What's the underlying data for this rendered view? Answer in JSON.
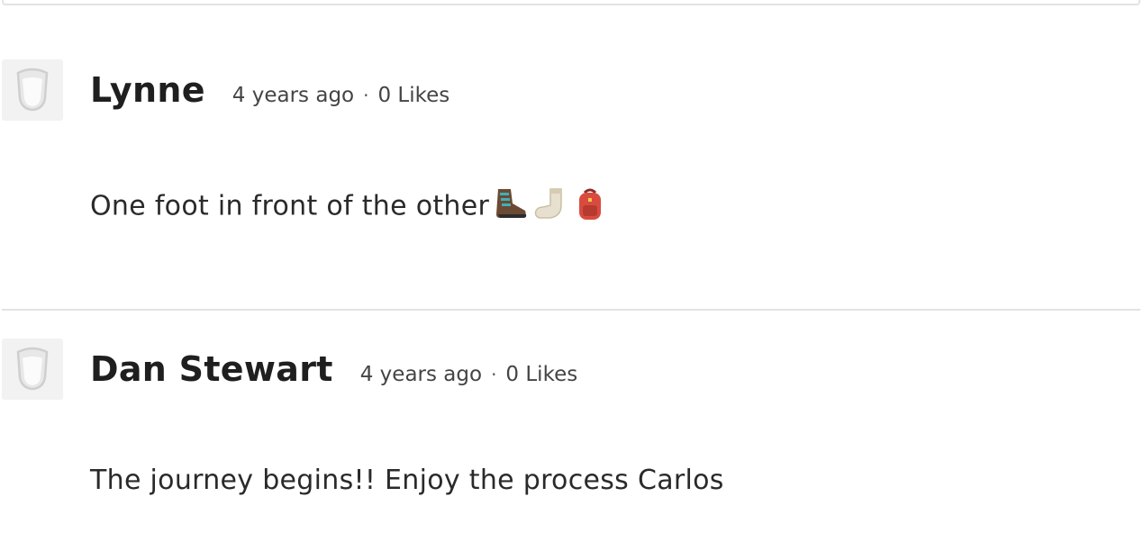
{
  "comments": [
    {
      "author": "Lynne",
      "time": "4 years ago",
      "separator": "·",
      "likes": "0 Likes",
      "text": "One foot in front of the other",
      "emoji_icons": [
        "hiking-boot-icon",
        "sock-icon",
        "backpack-icon"
      ]
    },
    {
      "author": "Dan Stewart",
      "time": "4 years ago",
      "separator": "·",
      "likes": "0 Likes",
      "text": "The journey begins!! Enjoy the process Carlos",
      "emoji_icons": []
    }
  ],
  "colors": {
    "avatar_bg": "#f2f2f2",
    "divider": "#e3e3e3",
    "author": "#1f1f1f",
    "meta": "#444444"
  },
  "avatar_icon": "default-avatar-icon"
}
